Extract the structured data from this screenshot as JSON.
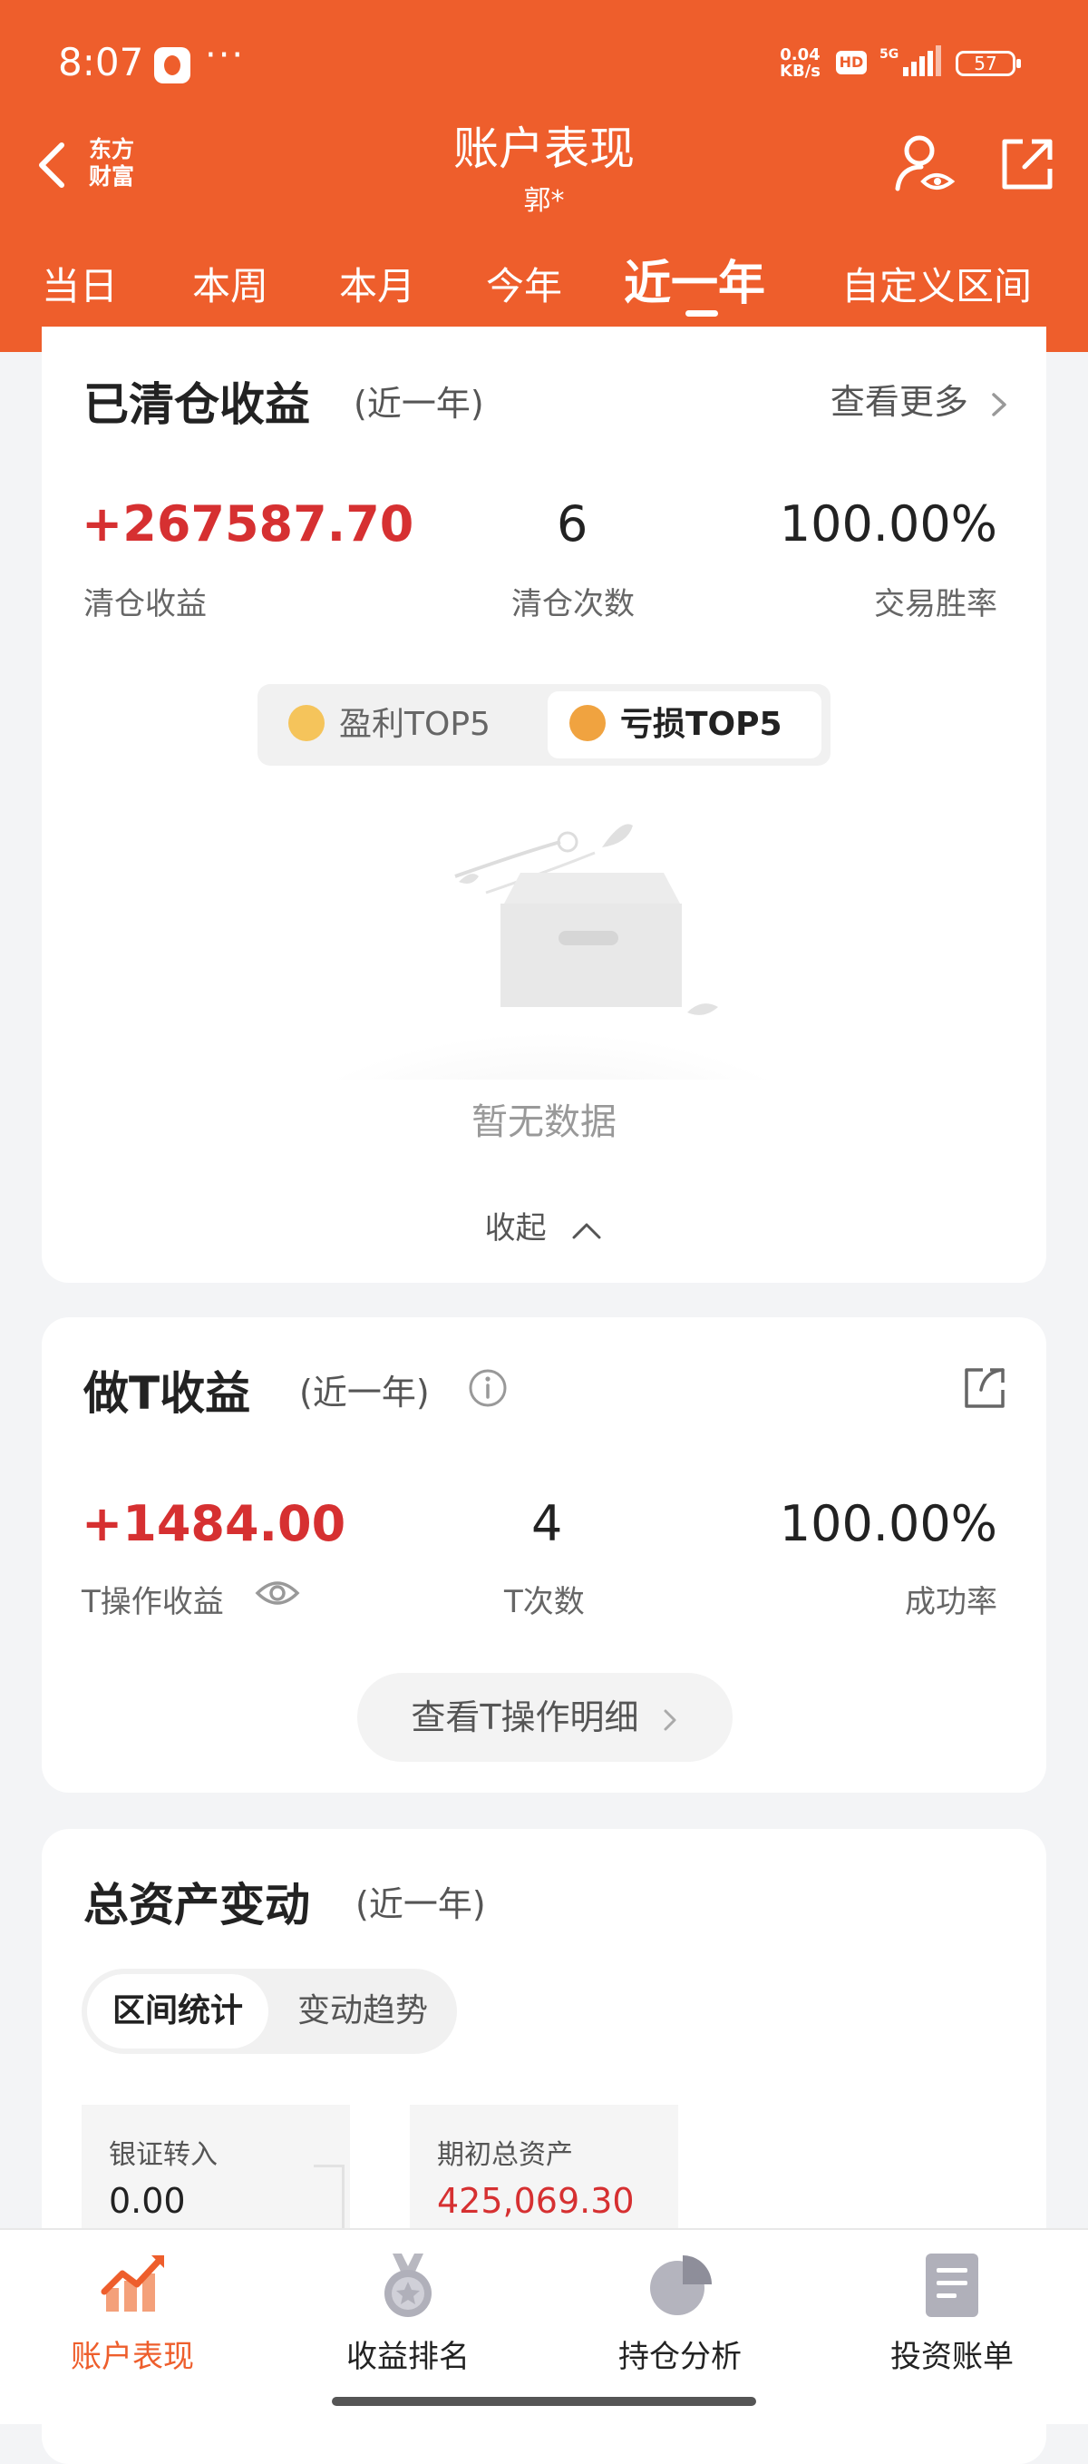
{
  "status_bar": {
    "time": "8:07",
    "more": "···",
    "net_speed_value": "0.04",
    "net_speed_unit": "KB/s",
    "hd": "HD",
    "network": "5G",
    "battery": "57"
  },
  "header": {
    "logo_line1": "东方",
    "logo_line2": "财富",
    "title": "账户表现",
    "subtitle": "郭*"
  },
  "tabs": [
    {
      "label": "当日",
      "active": false
    },
    {
      "label": "本周",
      "active": false
    },
    {
      "label": "本月",
      "active": false
    },
    {
      "label": "今年",
      "active": false
    },
    {
      "label": "近一年",
      "active": true
    },
    {
      "label": "自定义区间",
      "active": false
    }
  ],
  "cleared": {
    "title": "已清仓收益",
    "period": "(近一年)",
    "more": "查看更多",
    "profit_value": "+267587.70",
    "profit_label": "清仓收益",
    "count_value": "6",
    "count_label": "清仓次数",
    "winrate_value": "100.00%",
    "winrate_label": "交易胜率",
    "seg_profit": "盈利TOP5",
    "seg_loss": "亏损TOP5",
    "empty_text": "暂无数据",
    "collapse": "收起"
  },
  "t_trade": {
    "title": "做T收益",
    "period": "(近一年)",
    "profit_value": "+1484.00",
    "profit_label": "T操作收益",
    "count_value": "4",
    "count_label": "T次数",
    "success_value": "100.00%",
    "success_label": "成功率",
    "detail_button": "查看T操作明细"
  },
  "assets": {
    "title": "总资产变动",
    "period": "(近一年)",
    "seg_stats": "区间统计",
    "seg_trend": "变动趋势",
    "transfer_in_label": "银证转入",
    "transfer_in_value": "0.00",
    "initial_label": "期初总资产",
    "initial_value": "425,069.30"
  },
  "bottom_nav": [
    {
      "label": "账户表现",
      "icon": "chart-trend-icon",
      "active": true
    },
    {
      "label": "收益排名",
      "icon": "medal-icon",
      "active": false
    },
    {
      "label": "持仓分析",
      "icon": "pie-chart-icon",
      "active": false
    },
    {
      "label": "投资账单",
      "icon": "bill-icon",
      "active": false
    }
  ],
  "colors": {
    "brand": "#ee5e2c",
    "profit_red": "#d63031"
  }
}
